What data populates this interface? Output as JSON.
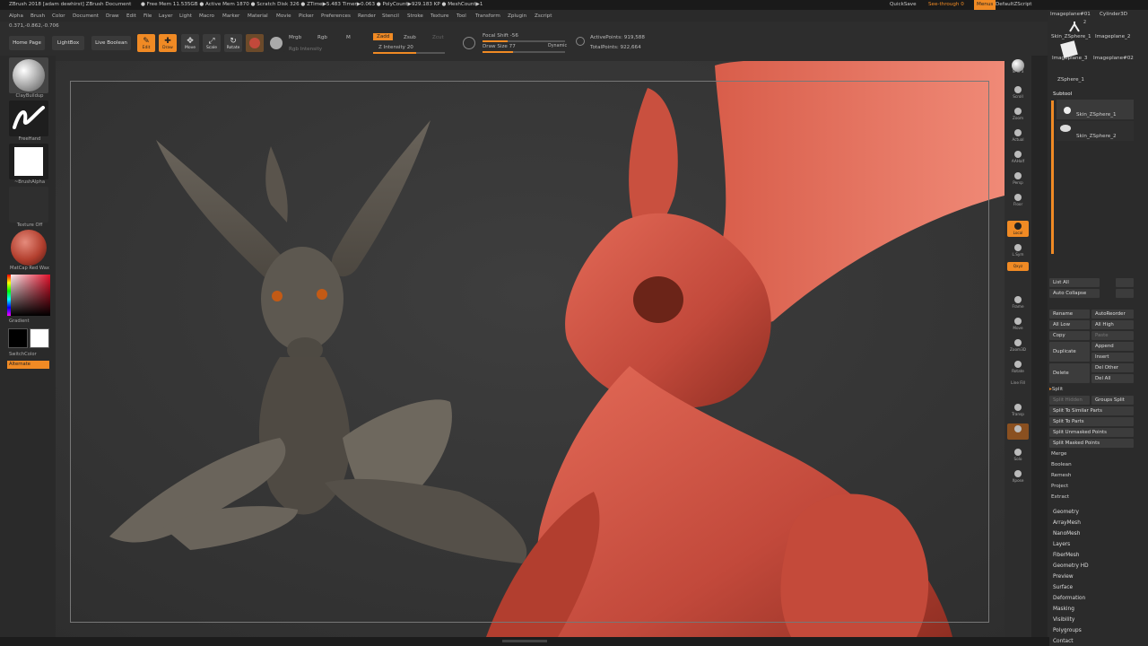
{
  "titlebar": {
    "app": "ZBrush 2018 [adam dewhirst]   ZBrush Document",
    "stats": "● Free Mem 11.535GB ● Active Mem 1870 ● Scratch Disk 326 ● ZTime▶5.483 Timer▶0.063 ● PolyCount▶929.183 KP ● MeshCount▶1",
    "quicksave": "QuickSave",
    "seethrough": "See-through  0",
    "menus": "Menus",
    "script": "DefaultZScript"
  },
  "menubar": [
    "Alpha",
    "Brush",
    "Color",
    "Document",
    "Draw",
    "Edit",
    "File",
    "Layer",
    "Light",
    "Macro",
    "Marker",
    "Material",
    "Movie",
    "Picker",
    "Preferences",
    "Render",
    "Stencil",
    "Stroke",
    "Texture",
    "Tool",
    "Transform",
    "Zplugin",
    "Zscript"
  ],
  "coords": "0.371,-0.862,-0.706",
  "toolbar": {
    "home": "Home Page",
    "lightbox": "LightBox",
    "liveboolean": "Live Boolean",
    "edit": "Edit",
    "draw": "Draw",
    "move": "Move",
    "scale": "Scale",
    "rotate": "Rotate",
    "mrgb": "Mrgb",
    "rgb": "Rgb",
    "m": "M",
    "rgb_intensity": "Rgb Intensity",
    "zadd": "Zadd",
    "zsub": "Zsub",
    "zcut": "Zcut",
    "z_intensity": "Z Intensity 20",
    "focal": "Focal Shift -56",
    "drawsize": "Draw Size 77",
    "dynamic": "Dynamic",
    "active_points": "ActivePoints: 919,588",
    "total_points": "TotalPoints: 922,664"
  },
  "leftpanel": {
    "brush": "ClayBuildup",
    "stroke": "FreeHand",
    "alpha": "~BrushAlpha",
    "texture": "Texture Off",
    "material": "MatCap Red Wax",
    "gradient": "Gradient",
    "switch": "SwitchColor",
    "alternate": "Alternate"
  },
  "rightshelf": [
    "SPix 3",
    "Scroll",
    "Zoom",
    "Actual",
    "AAHalf",
    "Persp",
    "Floor",
    "Local",
    "L.Sym",
    "Qxyz",
    "Frame",
    "Move",
    "Zoom3D",
    "Rotate",
    "Line Fill",
    "Transp",
    "Solo",
    "Xpose"
  ],
  "tray": {
    "tools": [
      "Imageplane#01",
      "Cylinder3D",
      "Skin_ZSphere_1",
      "Imageplane_2",
      "Imageplane_3",
      "Imageplane#02",
      "ZSphere_1"
    ],
    "tool_count": "2",
    "subtool_title": "Subtool",
    "subtools": [
      "Skin_ZSphere_1",
      "Skin_ZSphere_2"
    ],
    "list_all": "List All",
    "auto_collapse": "Auto Collapse",
    "rename": "Rename",
    "autoreorder": "AutoReorder",
    "all_low": "All Low",
    "all_high": "All High",
    "copy": "Copy",
    "paste": "Paste",
    "duplicate": "Duplicate",
    "append": "Append",
    "insert": "Insert",
    "delete": "Delete",
    "del_other": "Del Other",
    "del_all": "Del All",
    "split": "Split",
    "split_hidden": "Split Hidden",
    "groups_split": "Groups Split",
    "split_similar": "Split To Similar Parts",
    "split_parts": "Split To Parts",
    "split_unmasked": "Split Unmasked Points",
    "split_masked": "Split Masked Points",
    "merge": "Merge",
    "boolean": "Boolean",
    "remesh": "Remesh",
    "project": "Project",
    "extract": "Extract",
    "menus": [
      "Geometry",
      "ArrayMesh",
      "NanoMesh",
      "Layers",
      "FiberMesh",
      "Geometry HD",
      "Preview",
      "Surface",
      "Deformation",
      "Masking",
      "Visibility",
      "Polygroups",
      "Contact"
    ]
  },
  "colors": {
    "accent": "#f08a24",
    "clay": "#c2493b",
    "rabbit_bg": "#5f5a52"
  }
}
